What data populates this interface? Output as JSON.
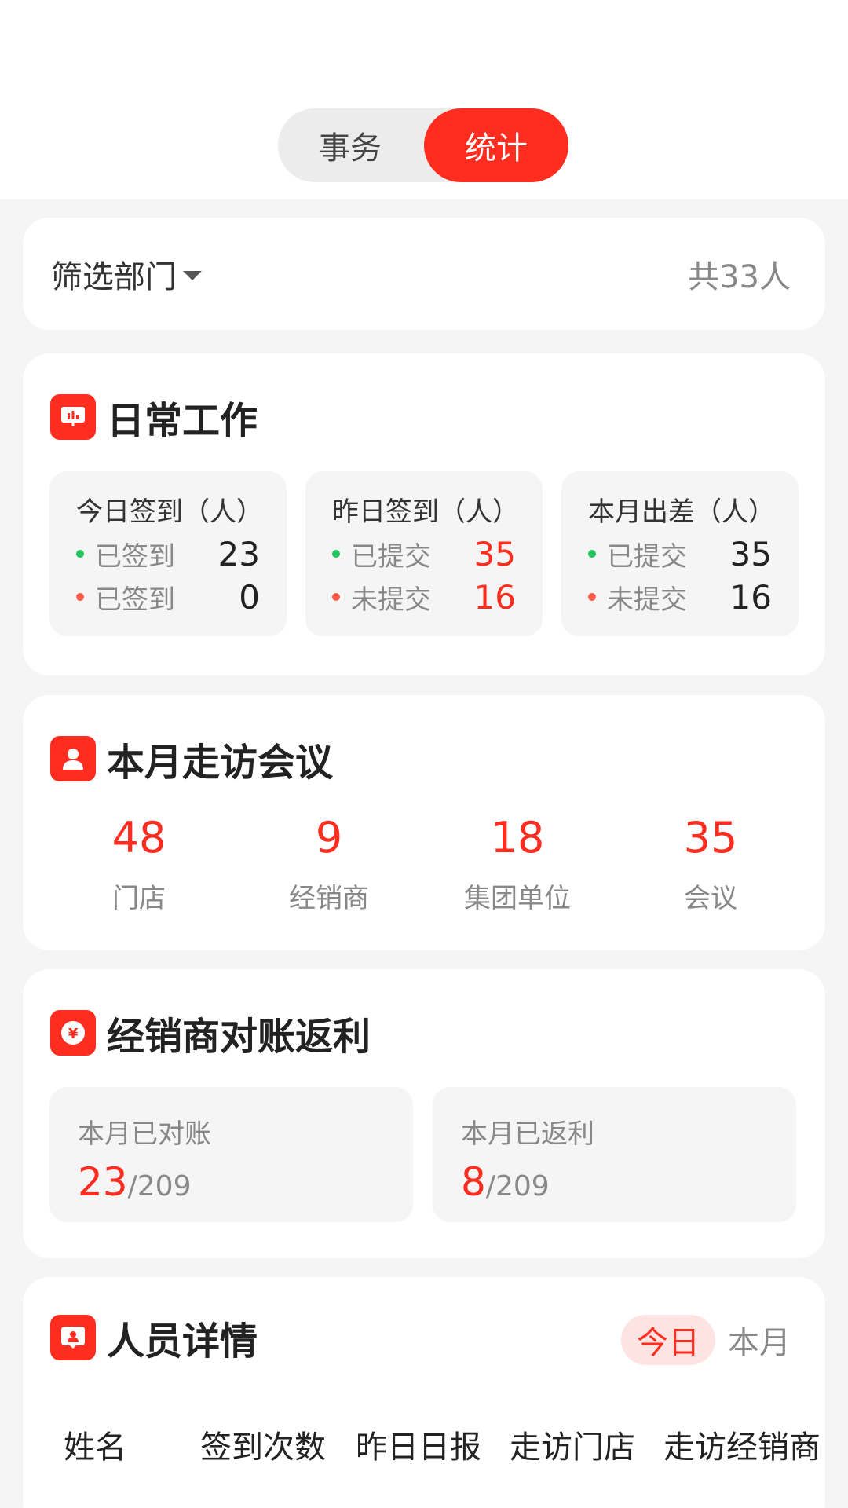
{
  "toggle": {
    "left": "事务",
    "right": "统计"
  },
  "filter": {
    "label": "筛选部门",
    "count": "共33人"
  },
  "daily": {
    "title": "日常工作",
    "boxes": [
      {
        "title": "今日签到（人）",
        "rows": [
          {
            "label": "已签到",
            "value": "23"
          },
          {
            "label": "已签到",
            "value": "0"
          }
        ]
      },
      {
        "title": "昨日签到（人）",
        "rows": [
          {
            "label": "已提交",
            "value": "35"
          },
          {
            "label": "未提交",
            "value": "16"
          }
        ]
      },
      {
        "title": "本月出差（人）",
        "rows": [
          {
            "label": "已提交",
            "value": "35"
          },
          {
            "label": "未提交",
            "value": "16"
          }
        ]
      }
    ]
  },
  "visits": {
    "title": "本月走访会议",
    "stats": [
      {
        "value": "48",
        "label": "门店"
      },
      {
        "value": "9",
        "label": "经销商"
      },
      {
        "value": "18",
        "label": "集团单位"
      },
      {
        "value": "35",
        "label": "会议"
      }
    ]
  },
  "rebate": {
    "title": "经销商对账返利",
    "boxes": [
      {
        "title": "本月已对账",
        "value": "23",
        "total": "/209"
      },
      {
        "title": "本月已返利",
        "value": "8",
        "total": "/209"
      }
    ]
  },
  "people": {
    "title": "人员详情",
    "tabs": [
      "今日",
      "本月"
    ],
    "columns": [
      "姓名",
      "签到次数",
      "昨日日报",
      "走访门店",
      "走访经销商"
    ]
  },
  "colors": {
    "accent": "#ff2d1f",
    "green": "#22c55e"
  }
}
